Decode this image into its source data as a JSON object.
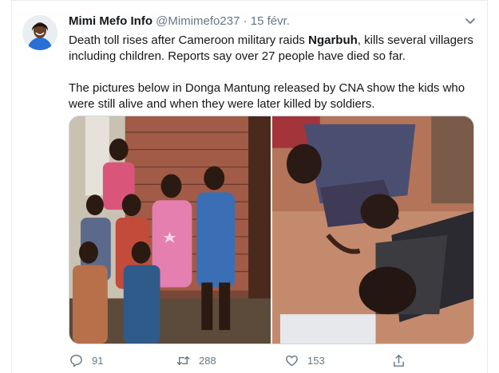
{
  "tweet": {
    "author": {
      "display_name": "Mimi Mefo Info",
      "handle": "@Mimimefo237",
      "separator": "·",
      "date": "15 févr."
    },
    "paragraph1": {
      "before": "Death toll rises after Cameroon military raids ",
      "bold": "Ngarbuh",
      "after": ", kills several villagers including children. Reports say over 27 people have died so far."
    },
    "paragraph2": "The pictures below in Donga Mantung released by CNA show the kids who were still alive and when they were later killed by soldiers.",
    "stats": {
      "replies": "91",
      "retweets": "288",
      "likes": "153"
    }
  },
  "icons": {
    "more": "chevron-down-icon",
    "reply": "speech-bubble-icon",
    "retweet": "retweet-arrows-icon",
    "like": "heart-icon",
    "share": "share-upload-icon"
  },
  "colors": {
    "text_primary": "#14171a",
    "text_secondary": "#657786",
    "border": "#e6ecf0"
  }
}
